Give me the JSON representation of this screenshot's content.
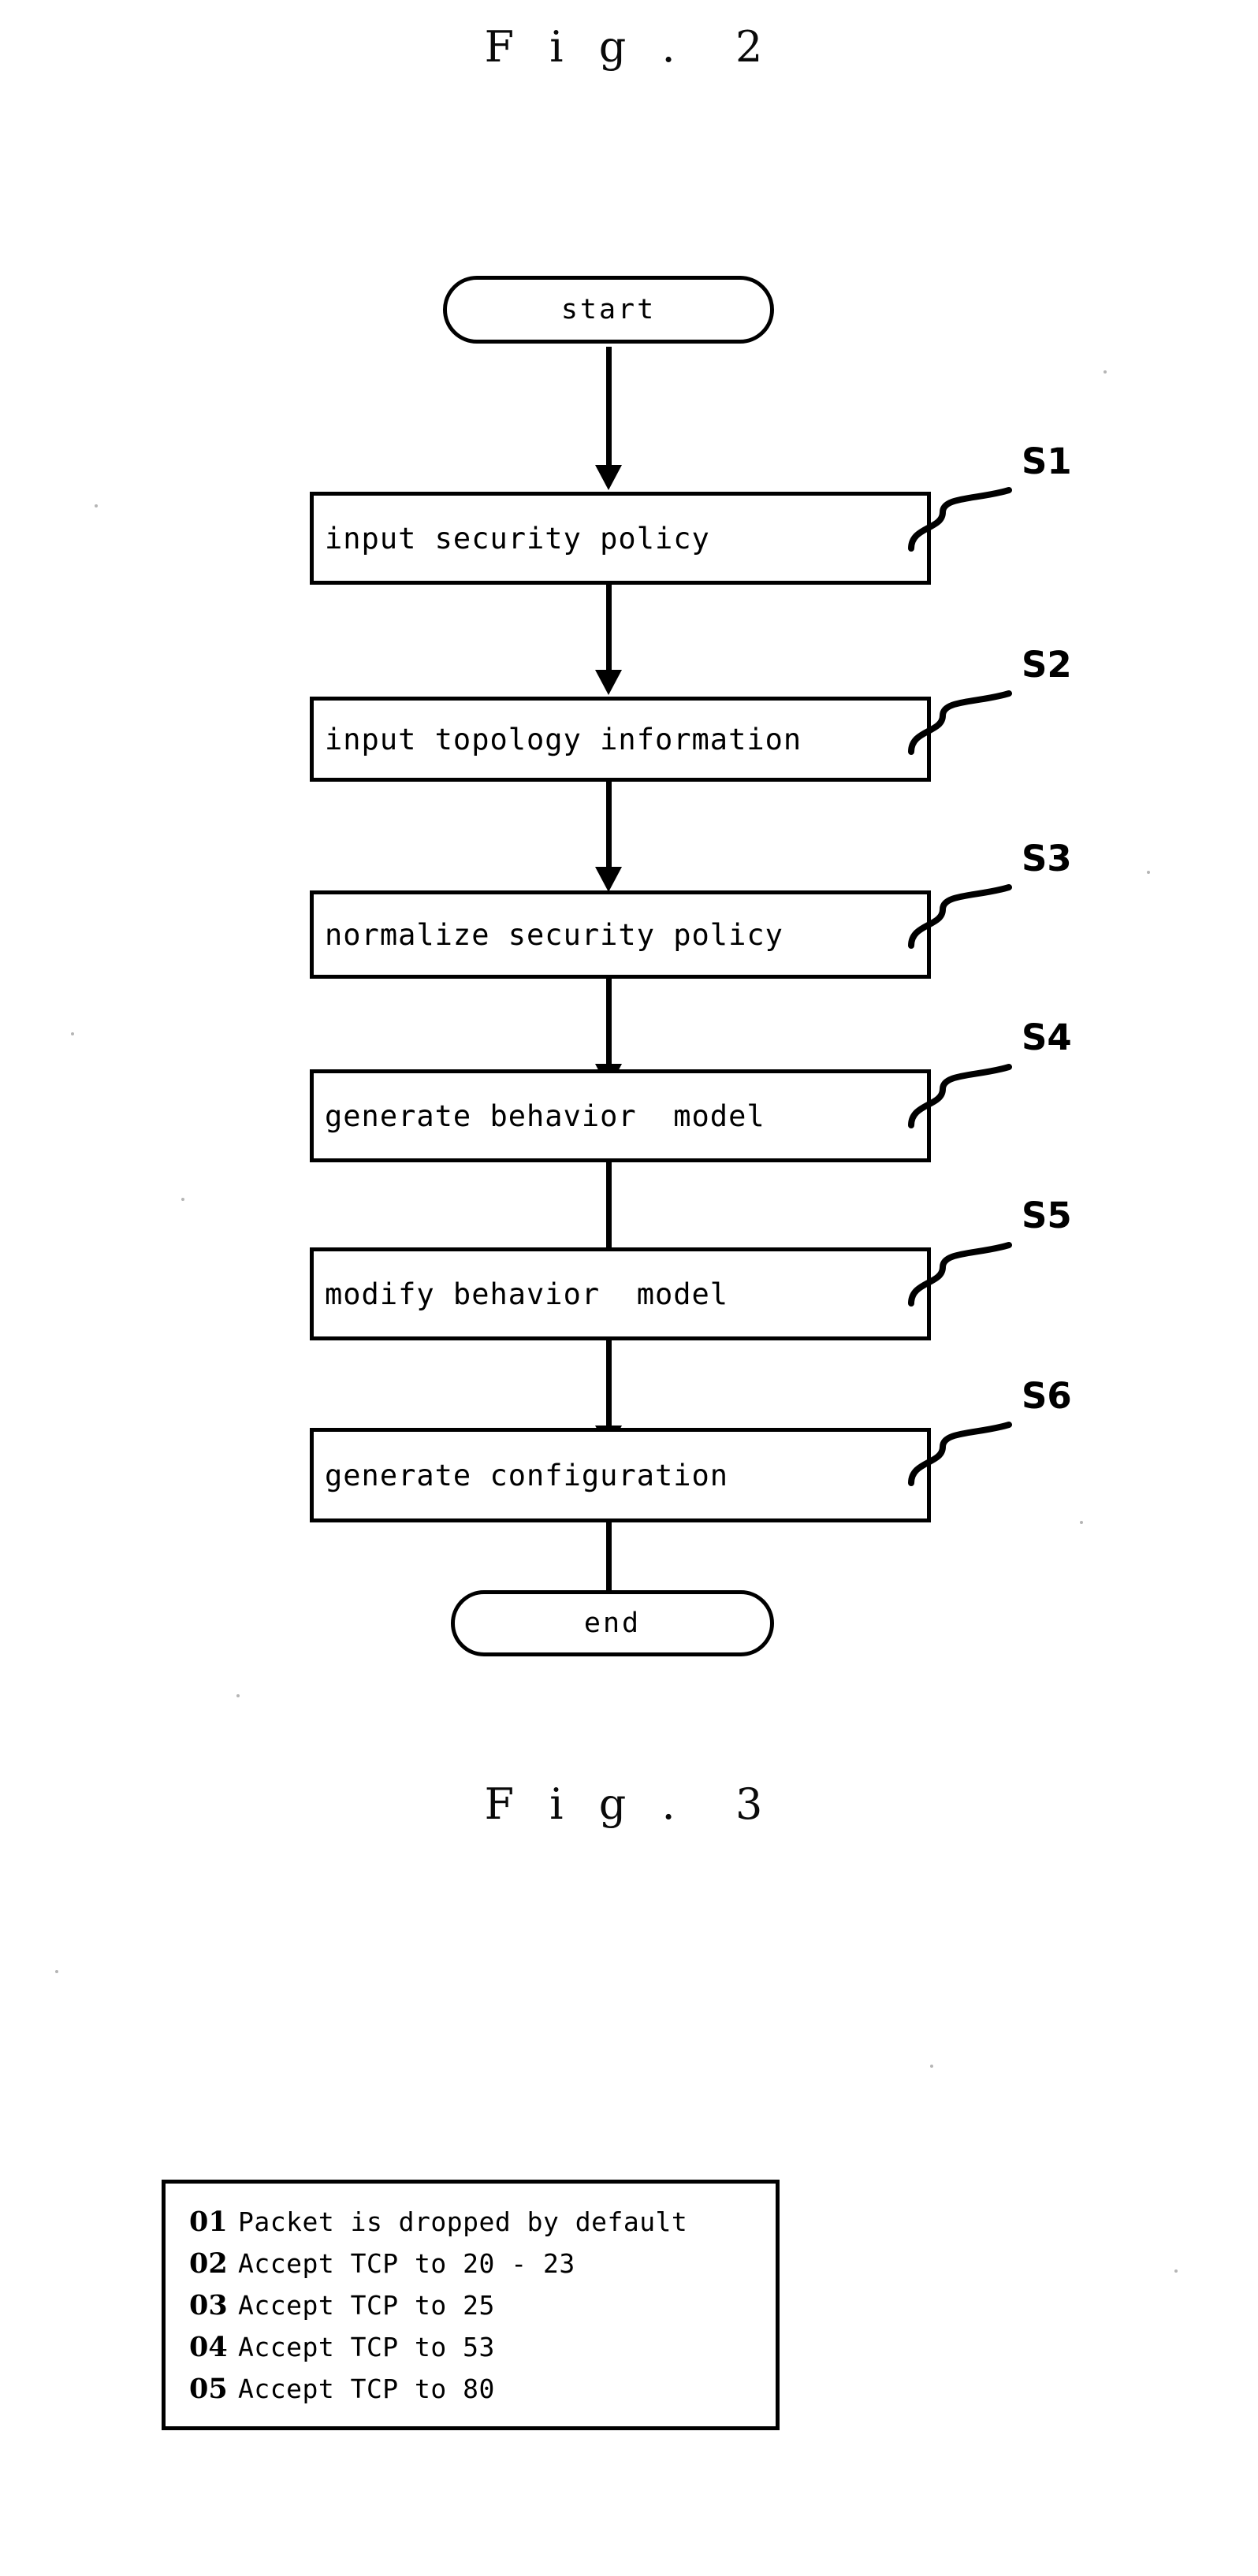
{
  "figures": [
    {
      "id": "fig2",
      "title": "F i g .  2"
    },
    {
      "id": "fig3",
      "title": "F i g .  3"
    }
  ],
  "flowchart": {
    "start_node": {
      "label": "start"
    },
    "end_node": {
      "label": "end"
    },
    "steps": [
      {
        "step_id": "S1",
        "label": "input security policy"
      },
      {
        "step_id": "S2",
        "label": "input topology information"
      },
      {
        "step_id": "S3",
        "label": "normalize security policy"
      },
      {
        "step_id": "S4",
        "label": "generate behavior  model"
      },
      {
        "step_id": "S5",
        "label": "modify behavior  model"
      },
      {
        "step_id": "S6",
        "label": "generate configuration"
      }
    ]
  },
  "code_listing": {
    "lines": [
      {
        "number": "01",
        "text": "Packet is dropped by default"
      },
      {
        "number": "02",
        "text": "Accept TCP to 20 - 23"
      },
      {
        "number": "03",
        "text": "Accept TCP to 25"
      },
      {
        "number": "04",
        "text": "Accept TCP to 53"
      },
      {
        "number": "05",
        "text": "Accept TCP to 80"
      }
    ]
  },
  "colors": {
    "ink": "#000000",
    "paper": "#ffffff"
  }
}
